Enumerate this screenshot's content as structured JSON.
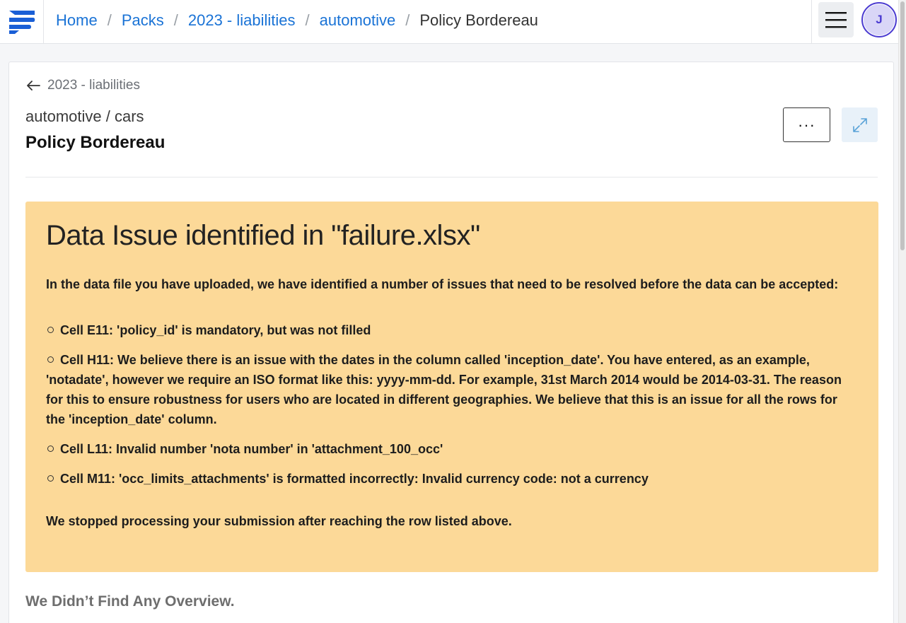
{
  "breadcrumb": {
    "home": "Home",
    "packs": "Packs",
    "pack": "2023 - liabilities",
    "category": "automotive",
    "current": "Policy Bordereau",
    "separator": "/"
  },
  "user": {
    "initial": "J"
  },
  "page": {
    "back_label": "2023 - liabilities",
    "subtitle": "automotive / cars",
    "title": "Policy Bordereau",
    "more_label": "···"
  },
  "alert": {
    "title": "Data Issue identified in \"failure.xlsx\"",
    "intro": "In the data file you have uploaded, we have identified a number of issues that need to be resolved before the data can be accepted:",
    "issues": [
      "Cell E11: 'policy_id' is mandatory, but was not filled",
      "Cell H11: We believe there is an issue with the dates in the column called 'inception_date'. You have entered, as an example, 'notadate', however we require an ISO format like this: yyyy-mm-dd. For example, 31st March 2014 would be 2014-03-31. The reason for this to ensure robustness for users who are located in different geographies. We believe that this is an issue for all the rows for the 'inception_date' column.",
      "Cell L11: Invalid number 'nota number' in 'attachment_100_occ'",
      "Cell M11: 'occ_limits_attachments' is formatted incorrectly: Invalid currency code: not a currency"
    ],
    "footer": "We stopped processing your submission after reaching the row listed above."
  },
  "empty_overview": "We Didn’t Find Any Overview.",
  "colors": {
    "link": "#1a73d6",
    "alert_bg": "#fcd998",
    "avatar_border": "#4b3bd1",
    "brand": "#1a5fd6"
  }
}
